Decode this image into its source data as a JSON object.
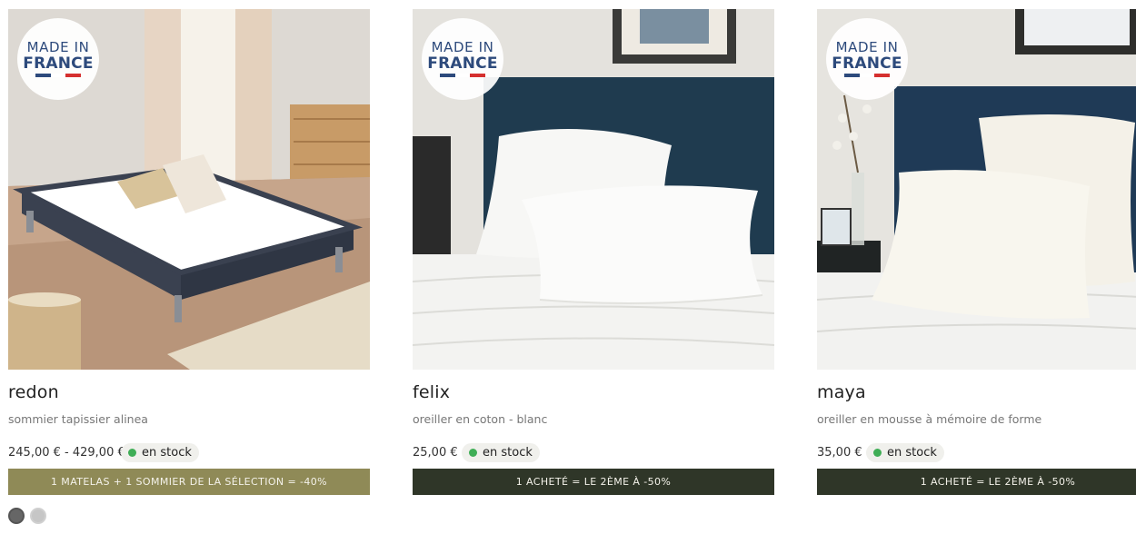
{
  "products": [
    {
      "badge": {
        "made": "MADE IN",
        "country": "FRANCE"
      },
      "name": "redon",
      "description": "sommier tapissier alinea",
      "price": "245,00 € - 429,00 €",
      "stock": "en stock",
      "promo": "1 MATELAS + 1 SOMMIER DE LA SÉLECTION = -40%",
      "promo_color": "#8f8a57",
      "swatches": [
        "dark-grey",
        "light-grey"
      ]
    },
    {
      "badge": {
        "made": "MADE IN",
        "country": "FRANCE"
      },
      "name": "felix",
      "description": "oreiller en coton - blanc",
      "price": "25,00 €",
      "stock": "en stock",
      "promo": "1 ACHETÉ = LE 2ÈME À -50%",
      "promo_color": "#2f3628"
    },
    {
      "badge": {
        "made": "MADE IN",
        "country": "FRANCE"
      },
      "name": "maya",
      "description": "oreiller en mousse à mémoire de forme",
      "price": "35,00 €",
      "stock": "en stock",
      "promo": "1 ACHETÉ = LE 2ÈME À -50%",
      "promo_color": "#2f3628"
    }
  ],
  "colors": {
    "flag_blue": "#2d4a7c",
    "flag_white": "#ffffff",
    "flag_red": "#d5302f",
    "stock_dot": "#3fae56"
  }
}
